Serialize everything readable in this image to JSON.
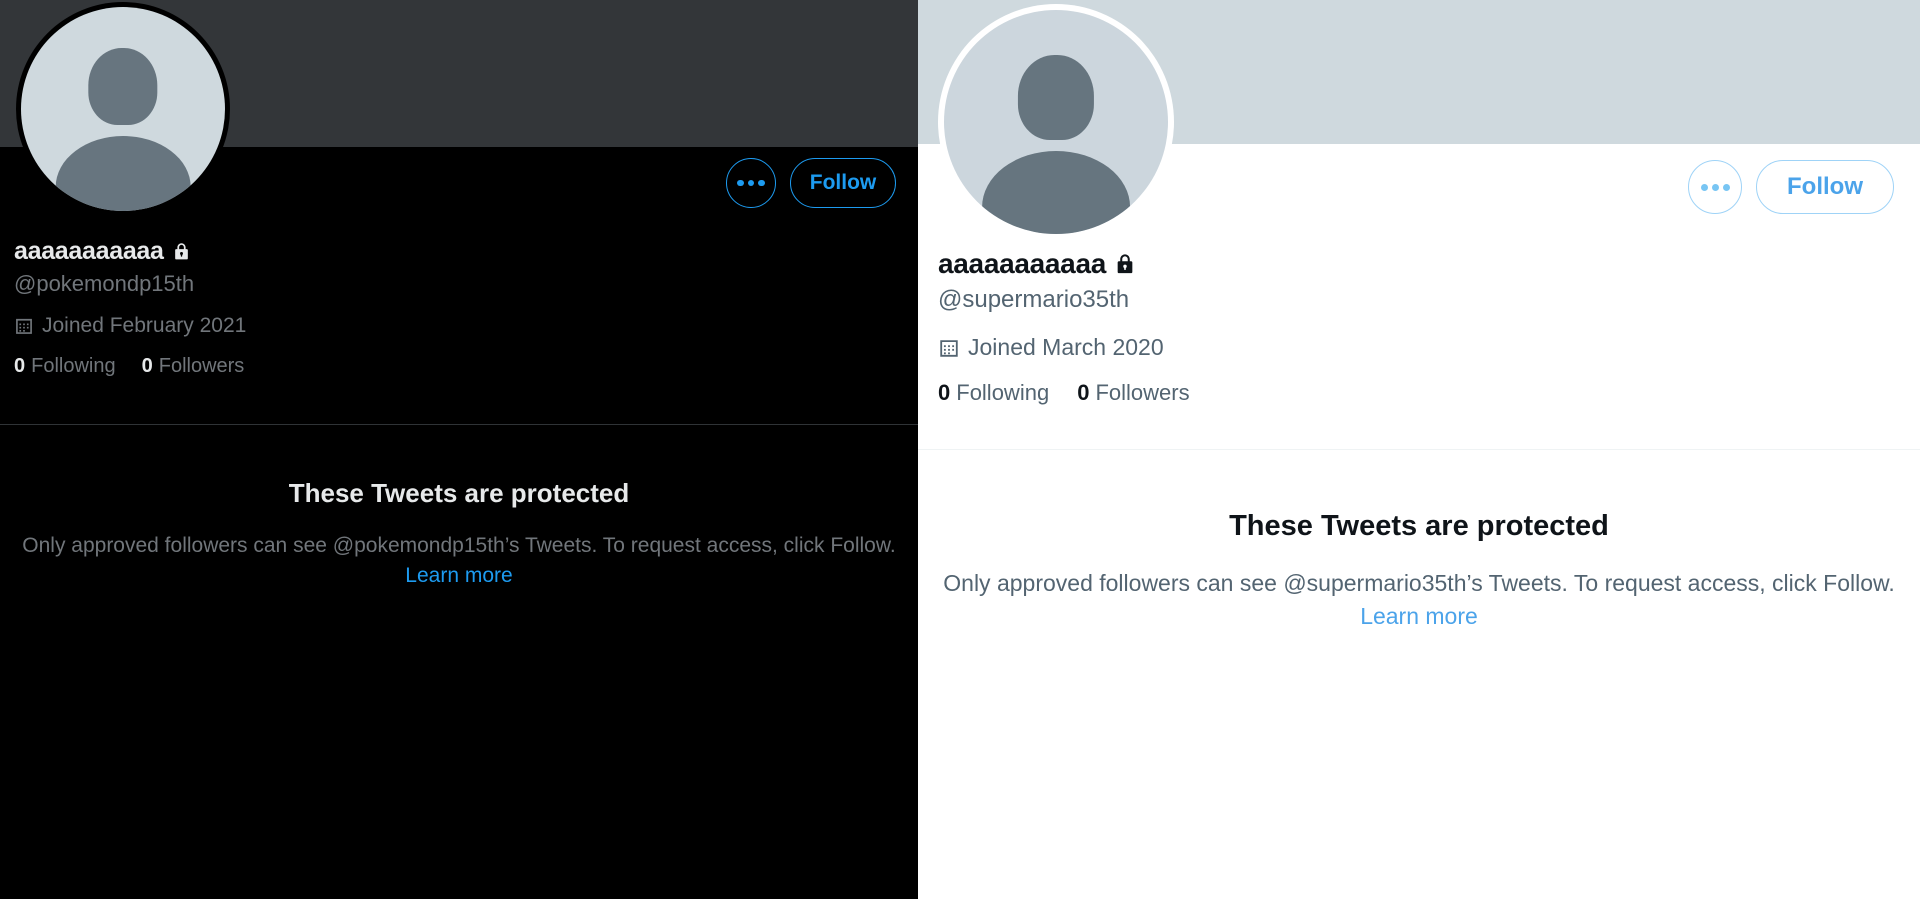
{
  "colors": {
    "dark_background": "#000000",
    "dark_banner": "#333639",
    "dark_text_primary": "#e7e9ea",
    "dark_text_secondary": "#71767b",
    "dark_accent": "#1d9bf0",
    "dark_divider": "#2f3336",
    "light_background": "#ffffff",
    "light_banner": "#cfd9de",
    "light_text_primary": "#0f1419",
    "light_text_secondary": "#536471",
    "light_accent": "#4ba3ea",
    "light_divider": "#eff3f4",
    "avatar_fill": "#cfd9de",
    "avatar_silhouette": "#66757f"
  },
  "dark_profile": {
    "theme": "dark",
    "banner_name": "profile-banner",
    "avatar": {
      "icon": "default-avatar-icon",
      "alt": "default profile photo"
    },
    "more_button": {
      "icon": "more-options-icon",
      "label": "…"
    },
    "follow_button": {
      "label": "Follow"
    },
    "display_name": "aaaaaaaaaaa",
    "protected_badge_icon": "lock-icon",
    "handle": "@pokemondp15th",
    "joined": {
      "icon": "calendar-icon",
      "text": "Joined February 2021"
    },
    "stats": [
      {
        "count": "0",
        "label": "Following"
      },
      {
        "count": "0",
        "label": "Followers"
      }
    ],
    "protected": {
      "title": "These Tweets are protected",
      "body_before": "Only approved followers can see @pokemondp15th’s Tweets. To request access, click Follow. ",
      "link": "Learn more"
    }
  },
  "light_profile": {
    "theme": "light",
    "banner_name": "profile-banner",
    "avatar": {
      "icon": "default-avatar-icon",
      "alt": "default profile photo"
    },
    "more_button": {
      "icon": "more-options-icon",
      "label": "…"
    },
    "follow_button": {
      "label": "Follow"
    },
    "display_name": "aaaaaaaaaaa",
    "protected_badge_icon": "lock-icon",
    "handle": "@supermario35th",
    "joined": {
      "icon": "calendar-icon",
      "text": "Joined March 2020"
    },
    "stats": [
      {
        "count": "0",
        "label": "Following"
      },
      {
        "count": "0",
        "label": "Followers"
      }
    ],
    "protected": {
      "title": "These Tweets are protected",
      "body_before": "Only approved followers can see @supermario35th’s Tweets. To request access, click Follow. ",
      "link": "Learn more"
    }
  }
}
